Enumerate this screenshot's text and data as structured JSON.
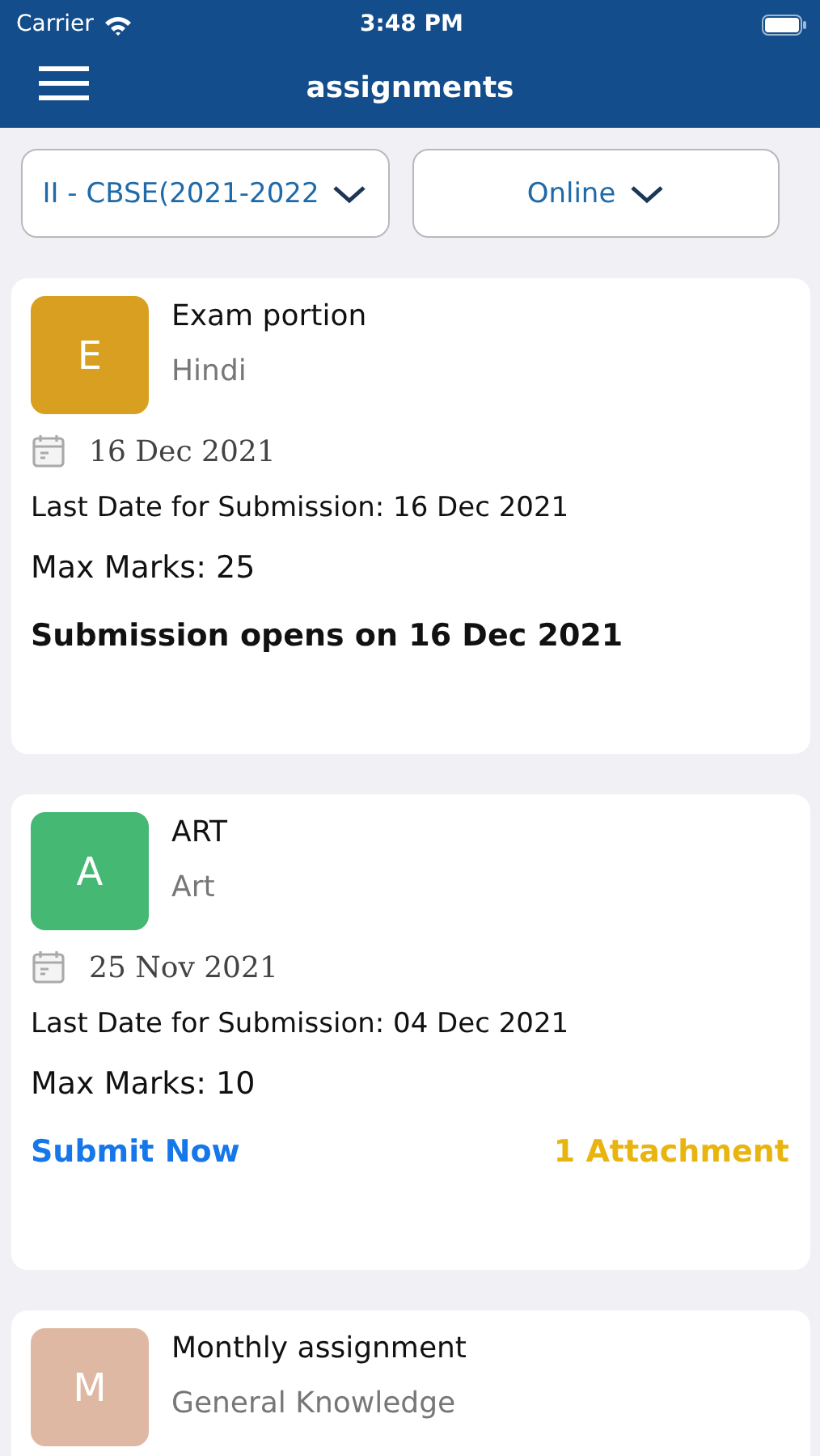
{
  "status_bar": {
    "carrier": "Carrier",
    "time": "3:48 PM"
  },
  "nav": {
    "title": "assignments"
  },
  "filters": [
    {
      "value": "II - CBSE(2021-2022"
    },
    {
      "value": "Online"
    }
  ],
  "assignments": [
    {
      "letter": "E",
      "color": "#d89f20",
      "title": "Exam portion",
      "subject": "Hindi",
      "date": "16 Dec 2021",
      "last_date": "Last Date for Submission: 16 Dec 2021",
      "max_marks": "Max Marks: 25",
      "footer": {
        "kind": "notice",
        "text": "Submission opens on 16 Dec 2021"
      }
    },
    {
      "letter": "A",
      "color": "#45b874",
      "title": "ART",
      "subject": "Art",
      "date": "25 Nov 2021",
      "last_date": "Last Date for Submission: 04 Dec 2021",
      "max_marks": "Max Marks: 10",
      "footer": {
        "kind": "actions",
        "link": "Submit Now",
        "attachments": "1 Attachment"
      }
    },
    {
      "letter": "M",
      "color": "#deb8a2",
      "title": "Monthly assignment",
      "subject": "General Knowledge"
    }
  ]
}
